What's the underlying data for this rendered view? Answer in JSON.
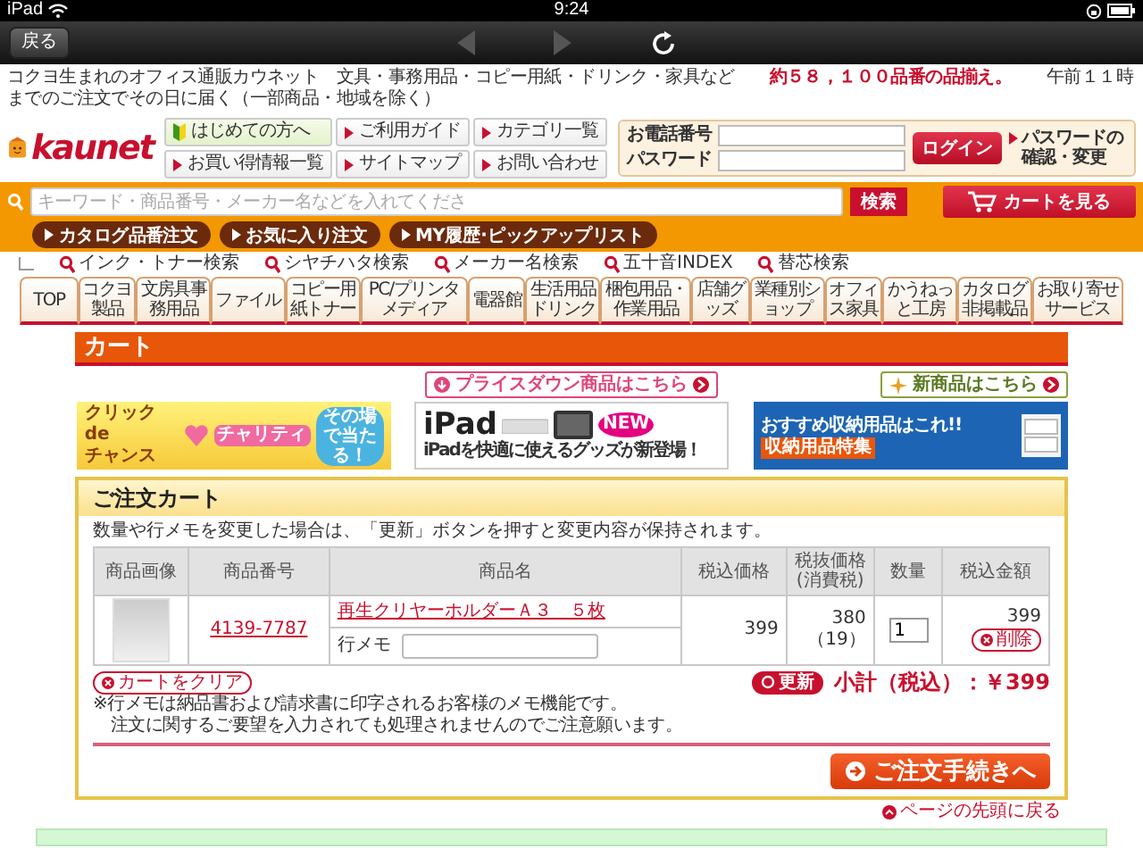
{
  "status_bar": {
    "device": "iPad",
    "time": "9:24"
  },
  "browser": {
    "back_button": "戻る"
  },
  "tagline": "コクヨ生まれのオフィス通販カウネット　文具・事務用品・コピー用紙・ドリンク・家具など　　**約５８，１００品番の品揃え。**　　午前１１時までのご注文でその日に届く（一部商品・地域を除く）",
  "logo": {
    "text": "kaunet"
  },
  "guide_links": [
    {
      "label": "はじめての方へ",
      "kind": "beginner"
    },
    {
      "label": "ご利用ガイド",
      "kind": "link"
    },
    {
      "label": "カテゴリ一覧",
      "kind": "link"
    },
    {
      "label": "お買い得情報一覧",
      "kind": "link"
    },
    {
      "label": "サイトマップ",
      "kind": "link"
    },
    {
      "label": "お問い合わせ",
      "kind": "link"
    }
  ],
  "login": {
    "phone_label": "お電話番号",
    "password_label": "パスワード",
    "button": "ログイン",
    "reset_link": "パスワードの確認・変更"
  },
  "search": {
    "placeholder": "キーワード・商品番号・メーカー名などを入れてくださ",
    "button": "検索"
  },
  "quick_orders": [
    "カタログ品番注文",
    "お気に入り注文",
    "MY履歴･ピックアップリスト"
  ],
  "cart_button": "カートを見る",
  "search_links": [
    "インク・トナー検索",
    "シヤチハタ検索",
    "メーカー名検索",
    "五十音INDEX",
    "替芯検索"
  ],
  "categories": [
    "TOP",
    "コクヨ製品",
    "文房具事務用品",
    "ファイル",
    "コピー用紙トナー",
    "PC/プリンタメディア",
    "電器館",
    "生活用品ドリンク",
    "梱包用品・作業用品",
    "店舗グッズ",
    "業種別ショップ",
    "オフィス家具",
    "かうねっと工房",
    "カタログ非掲載品",
    "お取り寄せサービス"
  ],
  "page_title": "カート",
  "promos": [
    {
      "label": "プライスダウン商品はこちら",
      "kind": "price-down"
    },
    {
      "label": "新商品はこちら",
      "kind": "new"
    }
  ],
  "banners": [
    {
      "kind": "click-chance",
      "texts": [
        "クリックde",
        "チャンス",
        "チャリティ",
        "その場で当たる！"
      ]
    },
    {
      "kind": "ipad",
      "texts": [
        "iPad",
        "iPadを快適に使えるグッズが新登場！",
        "NEW"
      ]
    },
    {
      "kind": "storage",
      "texts": [
        "おすすめ収納用品はこれ!!",
        "収納用品特集"
      ]
    }
  ],
  "cart": {
    "title": "ご注文カート",
    "note": "数量や行メモを変更した場合は、「更新」ボタンを押すと変更内容が保持されます。",
    "columns": [
      "商品画像",
      "商品番号",
      "商品名",
      "税込価格",
      "税抜価格(消費税)",
      "数量",
      "税込金額"
    ],
    "rows": [
      {
        "product_number": "4139-7787",
        "name": "再生クリヤーホルダーＡ３　５枚",
        "memo_label": "行メモ",
        "price": "399",
        "price_ex_tax": "380",
        "tax": "（19）",
        "quantity": "1",
        "amount": "399",
        "delete": "削除"
      }
    ],
    "clear_button": "カートをクリア",
    "update_button": "更新",
    "subtotal": "小計（税込）：￥399",
    "notes": [
      "※行メモは納品書および請求書に印字されるお客様のメモ機能です。",
      "注文に関するご要望を入力されても処理されませんのでご注意願います。"
    ],
    "checkout_button": "ご注文手続きへ"
  },
  "page_top_link": "ページの先頭に戻る"
}
